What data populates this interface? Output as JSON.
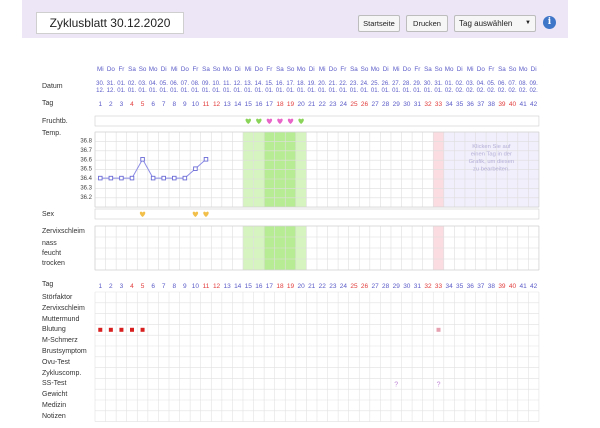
{
  "header": {
    "title": "Zyklusblatt 30.12.2020",
    "buttons": {
      "startseite": "Startseite",
      "drucken": "Drucken"
    },
    "select": "Tag auswählen",
    "info": "i"
  },
  "weekdays": [
    "Mi",
    "Do",
    "Fr",
    "Sa",
    "So",
    "Mo",
    "Di",
    "Mi",
    "Do",
    "Fr",
    "Sa",
    "So",
    "Mo",
    "Di",
    "Mi",
    "Do",
    "Fr",
    "Sa",
    "So",
    "Mo",
    "Di",
    "Mi",
    "Do",
    "Fr",
    "Sa",
    "So",
    "Mo",
    "Di",
    "Mi",
    "Do",
    "Fr",
    "Sa",
    "So",
    "Mo",
    "Di",
    "Mi",
    "Do",
    "Fr",
    "Sa",
    "So",
    "Mo",
    "Di"
  ],
  "dates_top": [
    "30.",
    "31.",
    "01.",
    "02.",
    "03.",
    "04.",
    "05.",
    "06.",
    "07.",
    "08.",
    "09.",
    "10.",
    "11.",
    "12.",
    "13.",
    "14.",
    "15.",
    "16.",
    "17.",
    "18.",
    "19.",
    "20.",
    "21.",
    "22.",
    "23.",
    "24.",
    "25.",
    "26.",
    "27.",
    "28.",
    "29.",
    "30.",
    "31.",
    "01.",
    "02.",
    "03.",
    "04.",
    "05.",
    "06.",
    "07.",
    "08.",
    "09."
  ],
  "dates_bottom": [
    "12.",
    "12.",
    "01.",
    "01.",
    "01.",
    "01.",
    "01.",
    "01.",
    "01.",
    "01.",
    "01.",
    "01.",
    "01.",
    "01.",
    "01.",
    "01.",
    "01.",
    "01.",
    "01.",
    "01.",
    "01.",
    "01.",
    "01.",
    "01.",
    "01.",
    "01.",
    "01.",
    "01.",
    "01.",
    "01.",
    "01.",
    "01.",
    "01.",
    "02.",
    "02.",
    "02.",
    "02.",
    "02.",
    "02.",
    "02.",
    "02.",
    "02."
  ],
  "days": [
    "1",
    "2",
    "3",
    "4",
    "5",
    "6",
    "7",
    "8",
    "9",
    "10",
    "11",
    "12",
    "13",
    "14",
    "15",
    "16",
    "17",
    "18",
    "19",
    "20",
    "21",
    "22",
    "23",
    "24",
    "25",
    "26",
    "27",
    "28",
    "29",
    "30",
    "31",
    "32",
    "33",
    "34",
    "35",
    "36",
    "37",
    "38",
    "39",
    "40",
    "41",
    "42"
  ],
  "red_days": [
    4,
    5,
    11,
    12,
    18,
    19,
    25,
    26,
    32,
    33,
    39,
    40
  ],
  "labels": {
    "datum": "Datum",
    "tag": "Tag",
    "fruchtb": "Fruchtb.",
    "temp": "Temp.",
    "sex": "Sex",
    "zervix": "Zervixschleim",
    "zervix_levels": [
      "nass",
      "feucht",
      "trocken"
    ],
    "tag2": "Tag",
    "bottom_rows": [
      "Störfaktor",
      "Zervixschleim",
      "Muttermund",
      "Blutung",
      "M-Schmerz",
      "Brustsymptom",
      "Ovu-Test",
      "Zykluscomp.",
      "SS-Test",
      "Gewicht",
      "Medizin",
      "Notizen"
    ]
  },
  "temp_axis": [
    "36.8",
    "36.7",
    "36.6",
    "36.5",
    "36.4",
    "36.3",
    "36.2"
  ],
  "temp_hint": "Klicken Sie auf einen Tag in der Grafik, um diesen zu bearbeiten.",
  "chart_data": {
    "type": "line",
    "xlabel": "Tag",
    "ylabel": "Temp.",
    "ylim": [
      36.2,
      36.8
    ],
    "x": [
      1,
      2,
      3,
      4,
      5,
      6,
      7,
      8,
      9,
      10,
      11
    ],
    "series": [
      {
        "values": [
          36.4,
          36.4,
          36.4,
          36.4,
          36.6,
          36.4,
          36.4,
          36.4,
          36.4,
          36.5,
          36.6
        ]
      }
    ]
  },
  "fertile_days": [
    15,
    16,
    17,
    18,
    19,
    20
  ],
  "highlight_day": 33,
  "fruchtb_markers": [
    {
      "day": 15,
      "color": "#8bd45a"
    },
    {
      "day": 16,
      "color": "#8bd45a"
    },
    {
      "day": 17,
      "color": "#e866c8"
    },
    {
      "day": 18,
      "color": "#e866c8"
    },
    {
      "day": 19,
      "color": "#e866c8"
    },
    {
      "day": 20,
      "color": "#8bd45a"
    }
  ],
  "sex_days": [
    5,
    10,
    11
  ],
  "blutung_days": [
    1,
    2,
    3,
    4,
    5
  ],
  "blutung_light_day": 33,
  "ss_test_days": [
    29,
    33
  ],
  "ss_test_symbol": "?",
  "colors": {
    "purple": "#5a5ac8",
    "red": "#e23b3b",
    "green": "#d5f4bf",
    "greenStrong": "#b8ec94",
    "pink": "#fbdde1",
    "line": "#8c8ce6"
  }
}
